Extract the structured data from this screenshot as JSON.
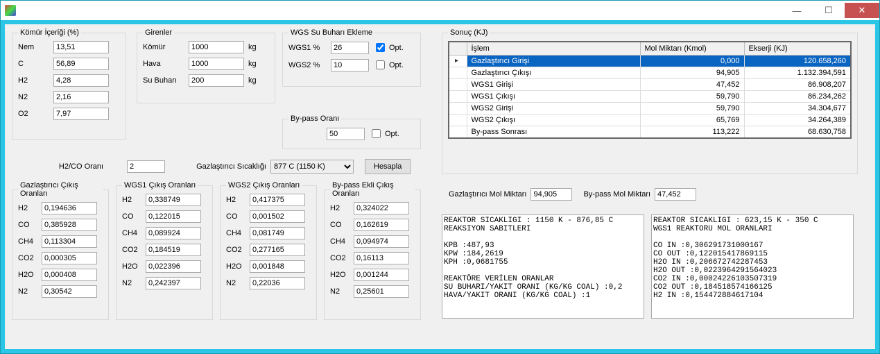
{
  "window": {
    "title": ""
  },
  "titlebar": {
    "minimize": "—",
    "maximize": "☐",
    "close": "✕"
  },
  "komur": {
    "legend": "Kömür İçeriği (%)",
    "nem_label": "Nem",
    "nem": "13,51",
    "c_label": "C",
    "c": "56,89",
    "h2_label": "H2",
    "h2": "4,28",
    "n2_label": "N2",
    "n2": "2,16",
    "o2_label": "O2",
    "o2": "7,97"
  },
  "girenler": {
    "legend": "Girenler",
    "komur_label": "Kömür",
    "komur": "1000",
    "komur_u": "kg",
    "hava_label": "Hava",
    "hava": "1000",
    "hava_u": "kg",
    "subuhari_label": "Su Buharı",
    "subuhari": "200",
    "subuhari_u": "kg"
  },
  "wgs": {
    "legend": "WGS Su Buharı Ekleme",
    "wgs1_label": "WGS1 %",
    "wgs1": "26",
    "wgs1_opt": "Opt.",
    "wgs2_label": "WGS2 %",
    "wgs2": "10",
    "wgs2_opt": "Opt."
  },
  "bypass": {
    "legend": "By-pass Oranı",
    "val": "50",
    "opt": "Opt."
  },
  "h2co": {
    "label": "H2/CO Oranı",
    "val": "2"
  },
  "temp": {
    "label": "Gazlaştırıcı Sıcaklığı",
    "val": "877 C (1150 K)"
  },
  "buttons": {
    "hesapla": "Hesapla"
  },
  "gcikis": {
    "legend": "Gazlaştırıcı Çıkış Oranları",
    "h2_l": "H2",
    "h2": "0,194636",
    "co_l": "CO",
    "co": "0,385928",
    "ch4_l": "CH4",
    "ch4": "0,113304",
    "co2_l": "CO2",
    "co2": "0,000305",
    "h2o_l": "H2O",
    "h2o": "0,000408",
    "n2_l": "N2",
    "n2": "0,30542"
  },
  "wgs1": {
    "legend": "WGS1 Çıkış Oranları",
    "h2_l": "H2",
    "h2": "0,338749",
    "co_l": "CO",
    "co": "0,122015",
    "ch4_l": "CH4",
    "ch4": "0,089924",
    "co2_l": "CO2",
    "co2": "0,184519",
    "h2o_l": "H2O",
    "h2o": "0,022396",
    "n2_l": "N2",
    "n2": "0,242397"
  },
  "wgs2": {
    "legend": "WGS2 Çıkış Oranları",
    "h2_l": "H2",
    "h2": "0,417375",
    "co_l": "CO",
    "co": "0,001502",
    "ch4_l": "CH4",
    "ch4": "0,081749",
    "co2_l": "CO2",
    "co2": "0,277165",
    "h2o_l": "H2O",
    "h2o": "0,001848",
    "n2_l": "N2",
    "n2": "0,22036"
  },
  "bpe": {
    "legend": "By-pass Ekli Çıkış Oranları",
    "h2_l": "H2",
    "h2": "0,324022",
    "co_l": "CO",
    "co": "0,162619",
    "ch4_l": "CH4",
    "ch4": "0,094974",
    "co2_l": "CO2",
    "co2": "0,16113",
    "h2o_l": "H2O",
    "h2o": "0,001244",
    "n2_l": "N2",
    "n2": "0,25601"
  },
  "sonuc": {
    "legend": "Sonuç (KJ)",
    "cols": {
      "islem": "İşlem",
      "mol": "Mol Miktarı (Kmol)",
      "ekserji": "Ekserji (KJ)"
    },
    "rows": [
      {
        "islem": "Gazlaştırıcı Girişi",
        "mol": "0,000",
        "ekserji": "120.658,260"
      },
      {
        "islem": "Gazlaştırıcı Çıkışı",
        "mol": "94,905",
        "ekserji": "1.132.394,591"
      },
      {
        "islem": "WGS1 Girişi",
        "mol": "47,452",
        "ekserji": "86.908,207"
      },
      {
        "islem": "WGS1 Çıkışı",
        "mol": "59,790",
        "ekserji": "86.234,262"
      },
      {
        "islem": "WGS2 Girişi",
        "mol": "59,790",
        "ekserji": "34.304,677"
      },
      {
        "islem": "WGS2 Çıkışı",
        "mol": "65,769",
        "ekserji": "34.264,389"
      },
      {
        "islem": "By-pass Sonrası",
        "mol": "113,222",
        "ekserji": "68.630,758"
      }
    ]
  },
  "summ": {
    "gmol_l": "Gazlaştırıcı Mol Miktarı",
    "gmol": "94,905",
    "bpmol_l": "By-pass Mol Miktarı",
    "bpmol": "47,452"
  },
  "log1": "REAKTOR SICAKLIGI : 1150 K - 876,85 C\nREAKSIYON SABITLERI\n\nKPB :487,93\nKPW :184,2619\nKPH :0,0681755\n\nREAKTÖRE VERİLEN ORANLAR\nSU BUHARI/YAKIT ORANI (KG/KG COAL) :0,2\nHAVA/YAKIT ORANI (KG/KG COAL) :1",
  "log2": "REAKTOR SICAKLIGI : 623,15 K - 350 C\nWGS1 REAKTORU MOL ORANLARI\n\nCO IN :0,306291731000167\nCO OUT :0,122015417869115\nH2O IN :0,206672742287453\nH2O OUT :0,0223964291564023\nCO2 IN :0,00024226103507319\nCO2 OUT :0,184518574166125\nH2 IN :0,154472884617104"
}
